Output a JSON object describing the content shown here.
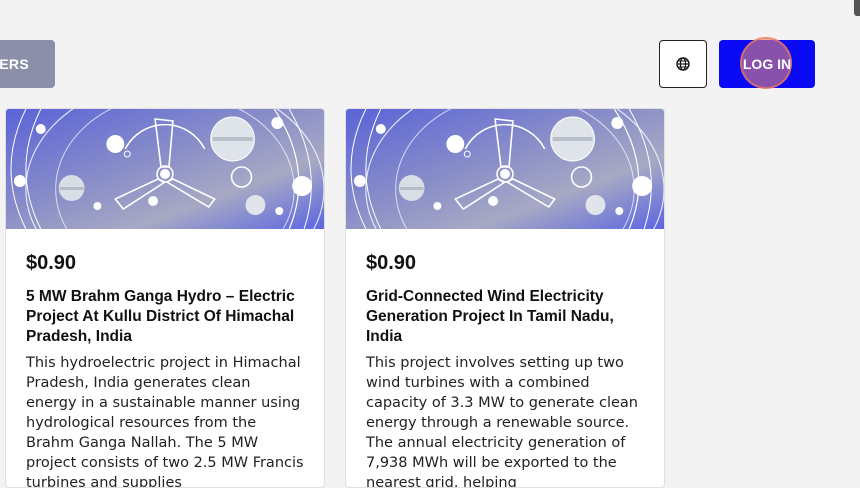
{
  "header": {
    "filters_label": "FILTERS",
    "language_icon": "globe-icon",
    "login_label": "LOG IN",
    "colors": {
      "login_bg": "#0a0af5",
      "filters_bg": "#8b8fa8"
    }
  },
  "projects": [
    {
      "price": "$0.90",
      "title": "5 MW Brahm Ganga Hydro – Electric Project At Kullu District Of Himachal Pradesh, India",
      "description": "This hydroelectric project in Himachal Pradesh, India generates clean energy in a sustainable manner using hydrological resources from the Brahm Ganga Nallah. The 5 MW project consists of two 2.5 MW Francis turbines and supplies"
    },
    {
      "price": "$0.90",
      "title": "Grid-Connected Wind Electricity Generation Project In Tamil Nadu, India",
      "description": "This project involves setting up two wind turbines with a combined capacity of 3.3 MW to generate clean energy through a renewable source. The annual electricity generation of 7,938 MWh will be exported to the nearest grid, helping"
    }
  ]
}
